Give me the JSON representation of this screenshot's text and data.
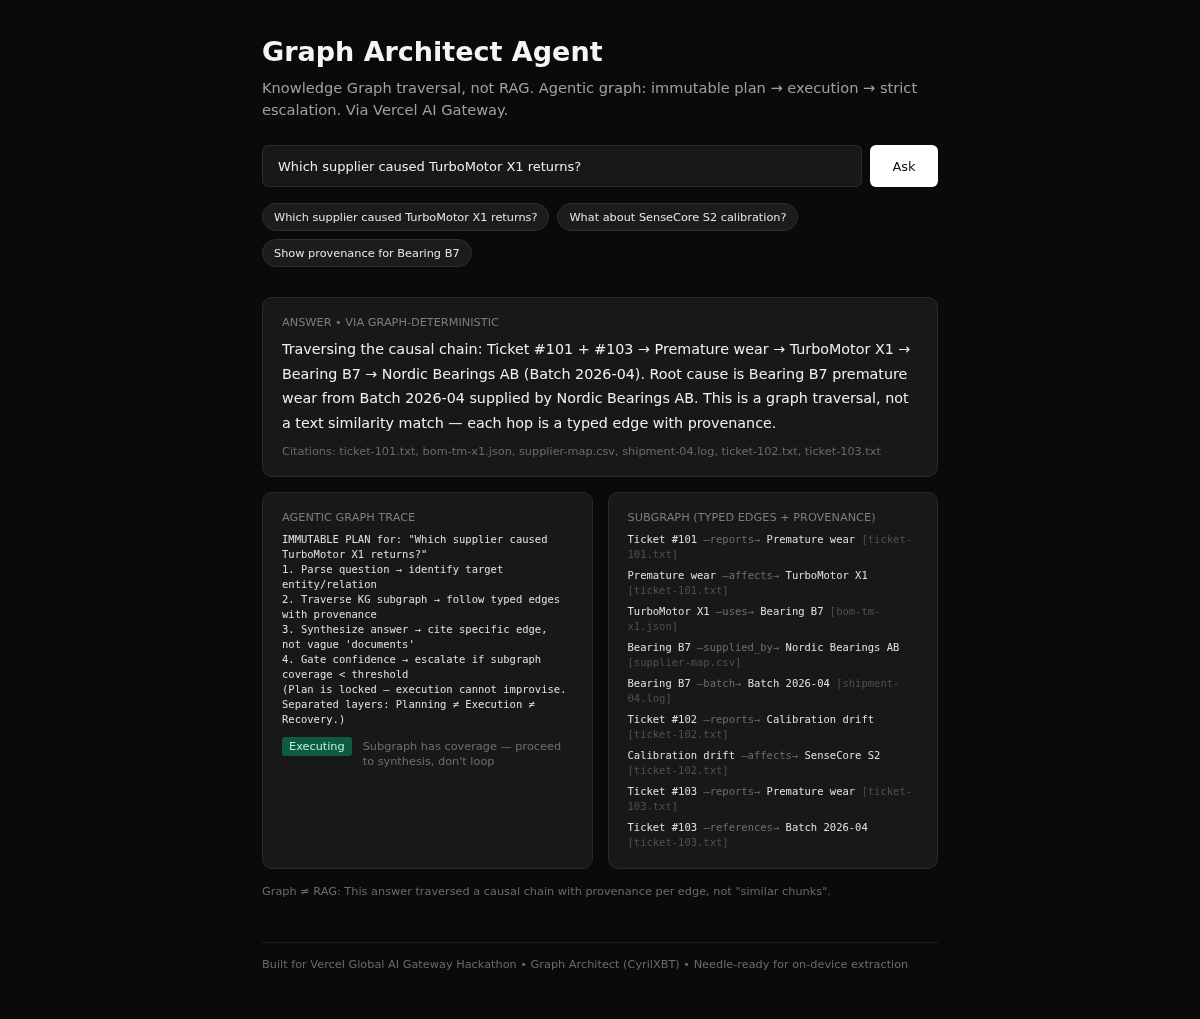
{
  "header": {
    "title": "Graph Architect Agent",
    "subtitle": "Knowledge Graph traversal, not RAG. Agentic graph: immutable plan → execution → strict escalation. Via Vercel AI Gateway."
  },
  "query": {
    "value": "Which supplier caused TurboMotor X1 returns?",
    "button": "Ask"
  },
  "suggestions": [
    "Which supplier caused TurboMotor X1 returns?",
    "What about SenseCore S2 calibration?",
    "Show provenance for Bearing B7"
  ],
  "answer": {
    "label": "ANSWER • VIA GRAPH-DETERMINISTIC",
    "text": "Traversing the causal chain: Ticket #101 + #103 → Premature wear → TurboMotor X1 → Bearing B7 → Nordic Bearings AB (Batch 2026-04). Root cause is Bearing B7 premature wear from Batch 2026-04 supplied by Nordic Bearings AB. This is a graph traversal, not a text similarity match — each hop is a typed edge with provenance.",
    "citations": "Citations: ticket-101.txt, bom-tm-x1.json, supplier-map.csv, shipment-04.log, ticket-102.txt, ticket-103.txt"
  },
  "trace": {
    "title": "AGENTIC GRAPH TRACE",
    "plan": [
      "IMMUTABLE PLAN for: \"Which supplier caused TurboMotor X1 returns?\"",
      "1. Parse question → identify target entity/relation",
      "2. Traverse KG subgraph → follow typed edges with provenance",
      "3. Synthesize answer → cite specific edge, not vague 'documents'",
      "4. Gate confidence → escalate if subgraph coverage < threshold",
      "(Plan is locked — execution cannot improvise. Separated layers: Planning ≠ Execution ≠ Recovery.)"
    ],
    "status": {
      "label": "Executing",
      "note": "Subgraph has coverage — proceed to synthesis, don't loop"
    }
  },
  "subgraph": {
    "title": "SUBGRAPH (TYPED EDGES + PROVENANCE)",
    "edges": [
      {
        "from": "Ticket #101",
        "relation": "—reports→",
        "to": "Premature wear",
        "source": "[ticket-101.txt]"
      },
      {
        "from": "Premature wear",
        "relation": "—affects→",
        "to": "TurboMotor X1",
        "source": "[ticket-101.txt]"
      },
      {
        "from": "TurboMotor X1",
        "relation": "—uses→",
        "to": "Bearing B7",
        "source": "[bom-tm-x1.json]"
      },
      {
        "from": "Bearing B7",
        "relation": "—supplied_by→",
        "to": "Nordic Bearings AB",
        "source": "[supplier-map.csv]"
      },
      {
        "from": "Bearing B7",
        "relation": "—batch→",
        "to": "Batch 2026-04",
        "source": "[shipment-04.log]"
      },
      {
        "from": "Ticket #102",
        "relation": "—reports→",
        "to": "Calibration drift",
        "source": "[ticket-102.txt]"
      },
      {
        "from": "Calibration drift",
        "relation": "—affects→",
        "to": "SenseCore S2",
        "source": "[ticket-102.txt]"
      },
      {
        "from": "Ticket #103",
        "relation": "—reports→",
        "to": "Premature wear",
        "source": "[ticket-103.txt]"
      },
      {
        "from": "Ticket #103",
        "relation": "—references→",
        "to": "Batch 2026-04",
        "source": "[ticket-103.txt]"
      }
    ]
  },
  "note": "Graph ≠ RAG: This answer traversed a causal chain with provenance per edge, not \"similar chunks\".",
  "footer": "Built for Vercel Global AI Gateway Hackathon • Graph Architect (CyrilXBT) • Needle-ready for on-device extraction"
}
